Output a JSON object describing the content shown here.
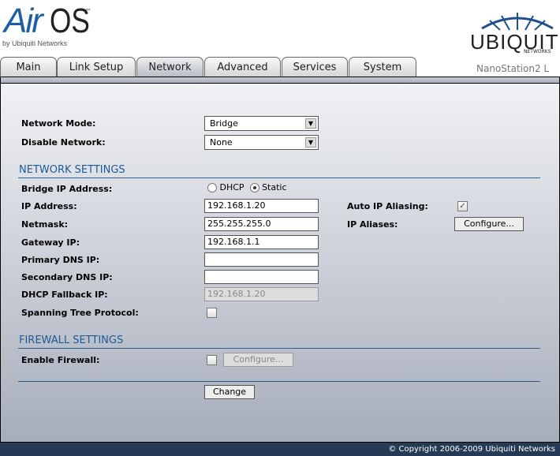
{
  "header": {
    "logo_air": "Air",
    "logo_os": "OS",
    "logo_tm": "™",
    "logo_by": "by Ubiquiti Networks",
    "brand": "UBIQUITI",
    "brand_sub": "NETWORKS",
    "model": "NanoStation2 L"
  },
  "tabs": [
    {
      "label": "Main"
    },
    {
      "label": "Link Setup"
    },
    {
      "label": "Network",
      "active": true
    },
    {
      "label": "Advanced"
    },
    {
      "label": "Services"
    },
    {
      "label": "System"
    }
  ],
  "form": {
    "network_mode": {
      "label": "Network Mode:",
      "value": "Bridge"
    },
    "disable_network": {
      "label": "Disable Network:",
      "value": "None"
    },
    "network_settings": {
      "title": "NETWORK SETTINGS",
      "bridge_ip": {
        "label": "Bridge IP Address:",
        "dhcp": "DHCP",
        "static": "Static",
        "selected": "Static"
      },
      "ip": {
        "label": "IP Address:",
        "value": "192.168.1.20"
      },
      "netmask": {
        "label": "Netmask:",
        "value": "255.255.255.0"
      },
      "gateway": {
        "label": "Gateway IP:",
        "value": "192.168.1.1"
      },
      "dns1": {
        "label": "Primary DNS IP:",
        "value": ""
      },
      "dns2": {
        "label": "Secondary DNS IP:",
        "value": ""
      },
      "fallback": {
        "label": "DHCP Fallback IP:",
        "value": "192.168.1.20"
      },
      "stp": {
        "label": "Spanning Tree Protocol:",
        "checked": false
      },
      "auto_alias": {
        "label": "Auto IP Aliasing:",
        "checked": true
      },
      "aliases": {
        "label": "IP Aliases:",
        "button": "Configure..."
      }
    },
    "firewall": {
      "title": "FIREWALL SETTINGS",
      "enable": {
        "label": "Enable Firewall:",
        "checked": false
      },
      "button": "Configure..."
    },
    "change_button": "Change"
  },
  "footer": {
    "copyright": "© Copyright 2006-2009 Ubiquiti Networks"
  },
  "colors": {
    "accent": "#1c5a99",
    "footer": "#253a55"
  }
}
